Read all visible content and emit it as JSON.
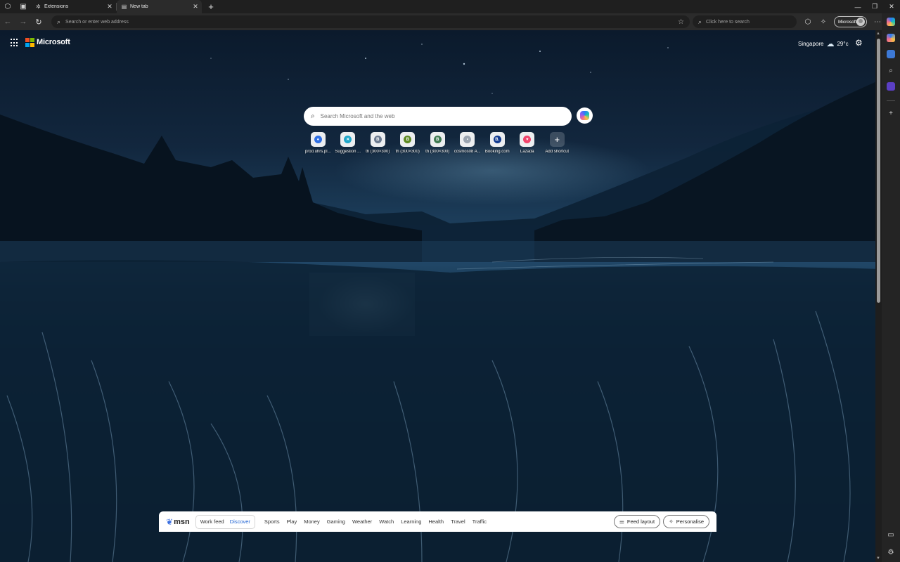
{
  "tabs": [
    {
      "label": "Extensions",
      "active": false,
      "icon": "puzzle-icon"
    },
    {
      "label": "New tab",
      "active": true,
      "icon": "page-icon"
    }
  ],
  "toolbar": {
    "address_placeholder": "Search or enter web address",
    "websearch_placeholder": "Click here to search",
    "profile_name": "Microsoft"
  },
  "page": {
    "brand": "Microsoft",
    "weather": {
      "city": "Singapore",
      "temp": "29°c"
    },
    "search_placeholder": "Search Microsoft and the web",
    "shortcuts": [
      {
        "label": "prod.uhrs.pl...",
        "color": "#2f6fe3",
        "glyph": "●"
      },
      {
        "label": "Suggestion ...",
        "color": "#1fa6c9",
        "glyph": "✕"
      },
      {
        "label": "th (300×300)",
        "color": "#6b7a8f",
        "glyph": "B"
      },
      {
        "label": "th (300×300)",
        "color": "#5d8a23",
        "glyph": "B"
      },
      {
        "label": "th (300×300)",
        "color": "#3f7a52",
        "glyph": "B"
      },
      {
        "label": "cosmos08 A...",
        "color": "#9aa4b0",
        "glyph": "•"
      },
      {
        "label": "Booking.com",
        "color": "#113a8f",
        "glyph": "B."
      },
      {
        "label": "Lazada",
        "color": "#f0446c",
        "glyph": "♥"
      }
    ],
    "add_shortcut": "Add shortcut"
  },
  "msn": {
    "logo": "msn",
    "feed_tabs": [
      "Work feed",
      "Discover"
    ],
    "active_feed": "Discover",
    "categories": [
      "Sports",
      "Play",
      "Money",
      "Gaming",
      "Weather",
      "Watch",
      "Learning",
      "Health",
      "Travel",
      "Traffic"
    ],
    "feed_layout": "Feed layout",
    "personalise": "Personalise"
  },
  "colors": {
    "accent": "#1a5fd1",
    "ms_logo": [
      "#f25022",
      "#7fba00",
      "#00a4ef",
      "#ffb900"
    ]
  }
}
